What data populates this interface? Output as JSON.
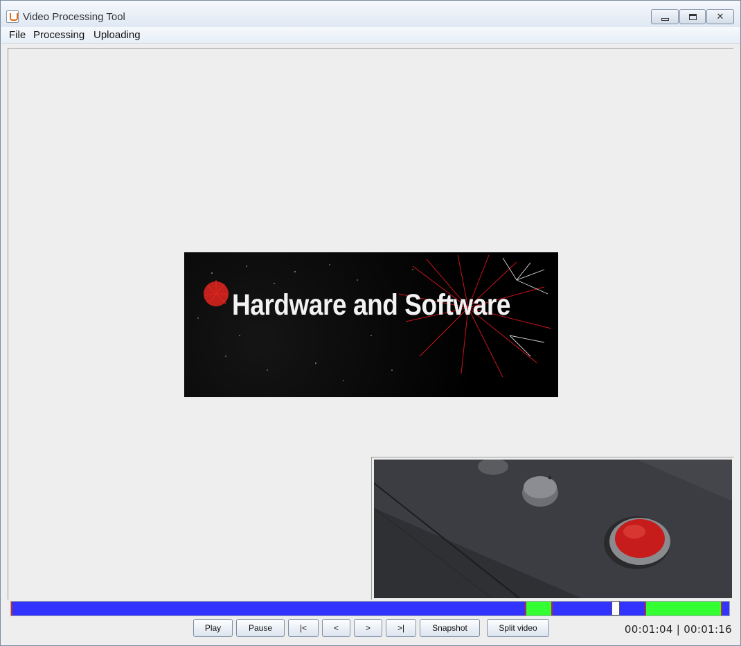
{
  "window": {
    "title": "Video Processing Tool",
    "controls": {
      "minimize_glyph": "",
      "maximize_glyph": "",
      "close_glyph": "✕"
    }
  },
  "menu": {
    "items": [
      {
        "label": "File"
      },
      {
        "label": "Processing"
      },
      {
        "label": "Uploading"
      }
    ]
  },
  "main_video": {
    "overlay_text": "Hardware and Software"
  },
  "timeline": {
    "position_fraction": 0.842,
    "segments": [
      {
        "color": "#3333ff",
        "start": 0.0,
        "end": 0.716
      },
      {
        "color": "#33ff33",
        "start": 0.716,
        "end": 0.752
      },
      {
        "color": "#3333ff",
        "start": 0.752,
        "end": 0.882
      },
      {
        "color": "#33ff33",
        "start": 0.882,
        "end": 0.988
      },
      {
        "color": "#3333ff",
        "start": 0.988,
        "end": 1.0
      }
    ],
    "markers": [
      0.0,
      0.716,
      0.752,
      0.882,
      0.988
    ]
  },
  "controls": {
    "buttons": [
      {
        "label": "Play"
      },
      {
        "label": "Pause"
      },
      {
        "label": "|<"
      },
      {
        "label": "<"
      },
      {
        "label": ">"
      },
      {
        "label": ">|"
      },
      {
        "label": "Snapshot"
      },
      {
        "label": "Split video"
      }
    ],
    "current_time": "00:01:04",
    "separator": "|",
    "total_time": "00:01:16"
  }
}
